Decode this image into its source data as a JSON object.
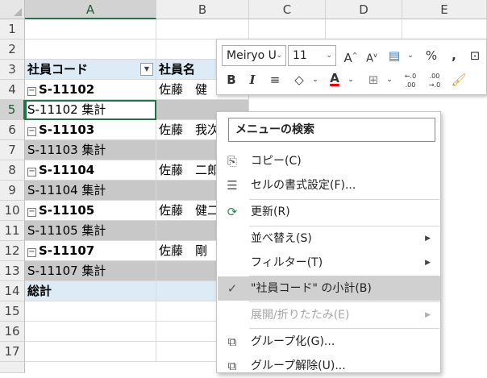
{
  "columns": [
    "A",
    "B",
    "C",
    "D",
    "E"
  ],
  "rows": [
    "1",
    "2",
    "3",
    "4",
    "5",
    "6",
    "7",
    "8",
    "9",
    "10",
    "11",
    "12",
    "13",
    "14",
    "15",
    "16",
    "17"
  ],
  "cells": {
    "a3": "社員コード",
    "b3": "社員名",
    "a4": "S-11102",
    "b4": "佐藤　健",
    "a5": "S-11102 集計",
    "a6": "S-11103",
    "b6": "佐藤　我次",
    "a7": "S-11103 集計",
    "a8": "S-11104",
    "b8": "佐藤　二郎",
    "a9": "S-11104 集計",
    "a10": "S-11105",
    "b10": "佐藤　健二",
    "a11": "S-11105 集計",
    "a12": "S-11107",
    "b12": "佐藤　剛",
    "a13": "S-11107 集計",
    "a14": "総計"
  },
  "mini_toolbar": {
    "font_name": "Meiryo U",
    "font_size": "11",
    "grow_font": "A",
    "shrink_font": "A",
    "percent": "%",
    "comma": ",",
    "bold": "B",
    "italic": "I",
    "font_color_label": "A",
    "increase_decimal": ".00",
    "decrease_decimal": ".00",
    "font_color": "#ff0000"
  },
  "context_menu": {
    "search_label": "メニューの検索",
    "items": [
      {
        "label": "コピー(C)",
        "icon": "copy-icon"
      },
      {
        "label": "セルの書式設定(F)...",
        "icon": "format-cells-icon"
      },
      {
        "label": "更新(R)",
        "icon": "refresh-icon"
      },
      {
        "label": "並べ替え(S)",
        "icon": "",
        "submenu": true
      },
      {
        "label": "フィルター(T)",
        "icon": "",
        "submenu": true
      },
      {
        "label": "\"社員コード\" の小計(B)",
        "icon": "check-icon",
        "checked": true
      },
      {
        "label": "展開/折りたたみ(E)",
        "icon": "",
        "submenu": true,
        "disabled": true
      },
      {
        "label": "グループ化(G)...",
        "icon": "group-icon"
      },
      {
        "label": "グループ解除(U)...",
        "icon": "ungroup-icon"
      }
    ]
  },
  "colors": {
    "accent": "#217346",
    "pivot_header": "#ddebf7",
    "subtotal_row": "#c8c8c8"
  }
}
